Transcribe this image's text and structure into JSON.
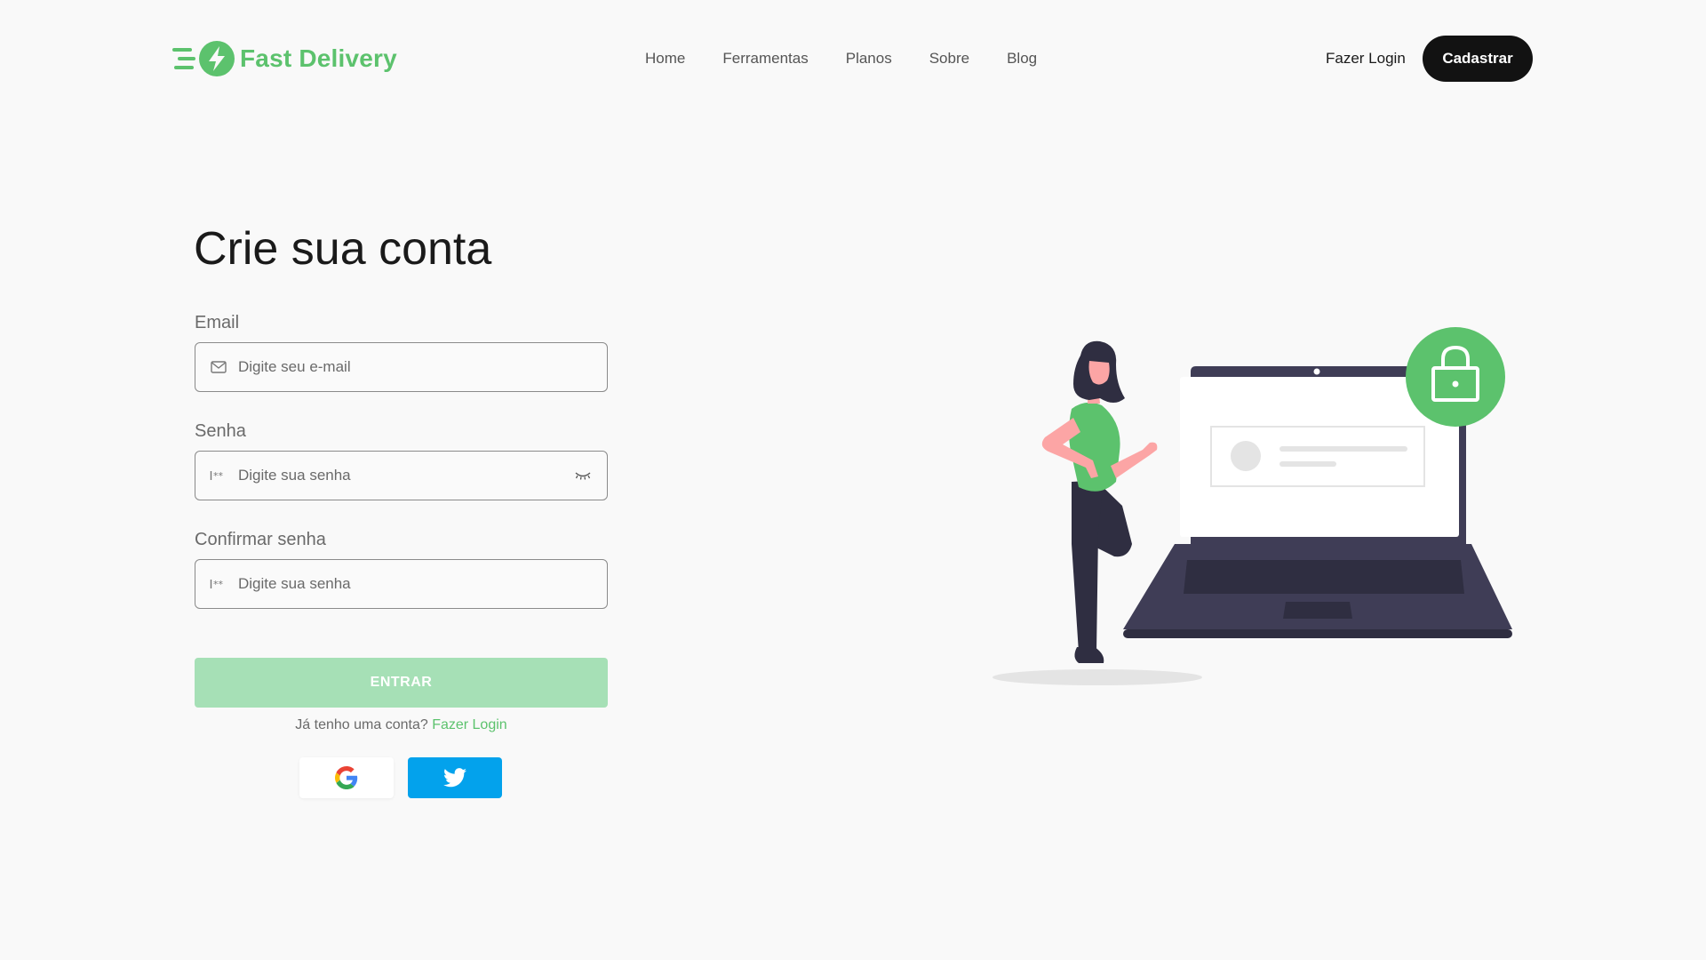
{
  "header": {
    "brand": "Fast Delivery",
    "nav": [
      "Home",
      "Ferramentas",
      "Planos",
      "Sobre",
      "Blog"
    ],
    "login_label": "Fazer Login",
    "signup_label": "Cadastrar"
  },
  "form": {
    "title": "Crie sua conta",
    "email": {
      "label": "Email",
      "placeholder": "Digite seu e-mail",
      "icon": "mail-icon"
    },
    "password": {
      "label": "Senha",
      "placeholder": "Digite sua senha",
      "icon": "password-icon",
      "toggle_icon": "eye-closed-icon"
    },
    "confirm_password": {
      "label": "Confirmar senha",
      "placeholder": "Digite sua senha",
      "icon": "password-icon"
    },
    "submit_label": "ENTRAR",
    "have_account_text": "Já tenho uma conta?",
    "have_account_link": "Fazer Login",
    "social": [
      "google-icon",
      "twitter-icon"
    ]
  },
  "colors": {
    "brand_green": "#5cc26d",
    "submit_disabled": "#a6e0b6",
    "twitter_blue": "#03a2ec",
    "dark_button": "#121212",
    "background": "#f9f9f9"
  },
  "illustration": {
    "subject": "woman-with-laptop-and-lock",
    "icon": "lock-icon"
  }
}
